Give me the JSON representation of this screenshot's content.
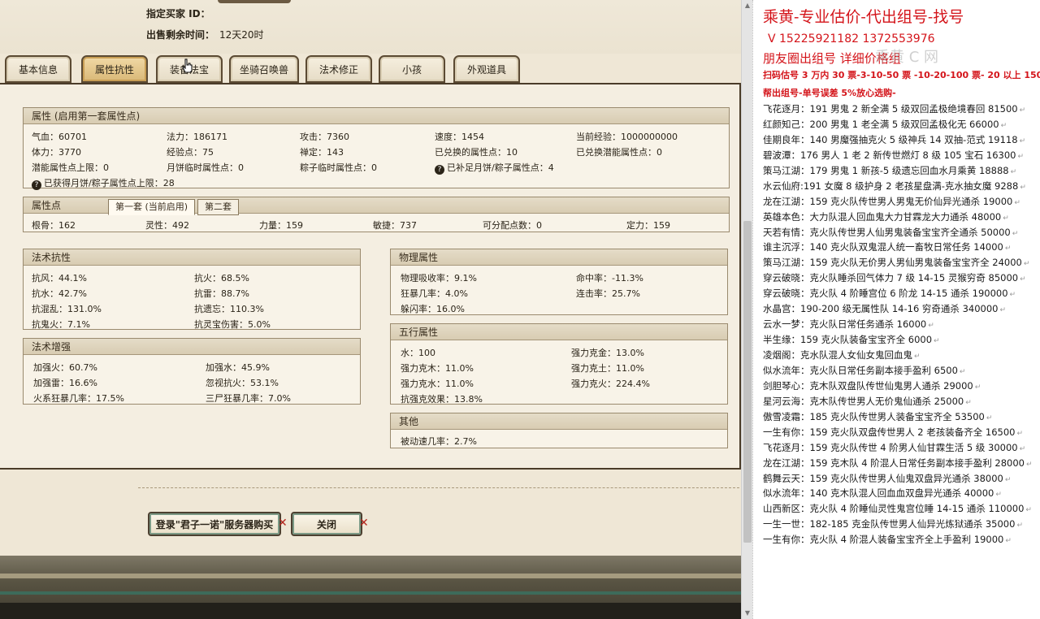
{
  "top_info": {
    "buyer_label": "指定买家 ID：",
    "remaining_label": "出售剩余时间：",
    "remaining_value": "12天20时"
  },
  "tabs": [
    {
      "label": "基本信息",
      "active": false
    },
    {
      "label": "属性抗性",
      "active": true
    },
    {
      "label": "装备法宝",
      "active": false
    },
    {
      "label": "坐骑召唤兽",
      "active": false
    },
    {
      "label": "法术修正",
      "active": false
    },
    {
      "label": "小孩",
      "active": false
    },
    {
      "label": "外观道具",
      "active": false
    }
  ],
  "attributes": {
    "title": "属性 (启用第一套属性点)",
    "row1": [
      "气血：60701",
      "法力：186171",
      "攻击：7360",
      "速度：1454",
      "当前经验：1000000000"
    ],
    "row2": [
      "体力：3770",
      "经验点：75",
      "禅定：143",
      "已兑换的属性点：10",
      "已兑换潜能属性点：0"
    ],
    "row3": [
      "潜能属性点上限：0",
      "月饼临时属性点：0",
      "粽子临时属性点：0",
      "已补足月饼/粽子属性点：4"
    ],
    "row4": "已获得月饼/粽子属性点上限：28"
  },
  "attr_points": {
    "title": "属性点",
    "subtab1": "第一套 (当前启用)",
    "subtab2": "第二套",
    "values": [
      "根骨：162",
      "灵性：492",
      "力量：159",
      "敏捷：737",
      "可分配点数：0",
      "定力：159"
    ]
  },
  "resist": {
    "title": "法术抗性",
    "rows": [
      [
        "抗风：44.1%",
        "抗火：68.5%"
      ],
      [
        "抗水：42.7%",
        "抗雷：88.7%"
      ],
      [
        "抗混乱：131.0%",
        "抗遗忘：110.3%"
      ],
      [
        "抗鬼火：7.1%",
        "抗灵宝伤害：5.0%"
      ]
    ]
  },
  "enhance": {
    "title": "法术增强",
    "rows": [
      [
        "加强火：60.7%",
        "加强水：45.9%"
      ],
      [
        "加强雷：16.6%",
        "忽视抗火：53.1%"
      ],
      [
        "火系狂暴几率：17.5%",
        "三尸狂暴几率：7.0%"
      ]
    ]
  },
  "physical": {
    "title": "物理属性",
    "rows": [
      [
        "物理吸收率：9.1%",
        "命中率：-11.3%"
      ],
      [
        "狂暴几率：4.0%",
        "连击率：25.7%"
      ],
      [
        "躲闪率：16.0%",
        ""
      ]
    ]
  },
  "five_elements": {
    "title": "五行属性",
    "rows": [
      [
        "水：100",
        "强力克金：13.0%"
      ],
      [
        "强力克木：11.0%",
        "强力克土：11.0%"
      ],
      [
        "强力克水：11.0%",
        "强力克火：224.4%"
      ],
      [
        "抗强克效果：13.8%",
        ""
      ]
    ]
  },
  "other": {
    "title": "其他",
    "value": "被动速几率：2.7%"
  },
  "buttons": {
    "login_buy": "登录\"君子一诺\"服务器购买",
    "close": "关闭"
  },
  "notes": {
    "title": "乘黄-专业估价-代出组号-找号",
    "phone": "V 15225921182   1372553976",
    "circle": "朋友圈出组号    详细价格组",
    "watermark": "乘黄 C 网",
    "price1": "扫码估号 3 万内 30 票-3-10-50 票 -10-20-100 票- 20 以上 150",
    "price2": "帮出组号-单号误差 5%放心选购-",
    "listing": [
      "飞花逐月：191 男鬼 2 新全满 5 级双回孟极绝境春回 81500",
      "红颜知己：200 男鬼 1 老全满 5 级双回孟极化无 66000",
      "佳期良年：140 男魔强抽克火 5 级神兵 14 双抽-范式 19118",
      "碧波潭：176 男人 1 老 2 新传世燃灯 8 级 105 宝石 16300",
      "策马江湖：179 男鬼 1 新孩-5 级遗忘回血水月乘黄 18888",
      "水云仙府:191 女魔 8 级护身 2 老孩星盘满-克水抽女魔 9288",
      "龙在江湖：159 克火队传世男人男鬼无价仙异光通杀 19000",
      "英雄本色：大力队混人回血鬼大力甘霖龙大力通杀 48000",
      "天若有情：克火队传世男人仙男鬼装备宝宝齐全通杀 50000",
      "谁主沉浮：140 克火队双鬼混人统一畜牧日常任务 14000",
      "策马江湖：159 克火队无价男人男仙男鬼装备宝宝齐全 24000",
      "穿云破晓：克火队睡杀回气体力 7 级 14-15 灵猴穷奇 85000",
      "穿云破晓：克火队 4 阶睡宫位 6 阶龙 14-15 通杀 190000",
      "水晶宫：190-200 级无属性队 14-16 穷奇通杀 340000",
      "云水一梦：克火队日常任务通杀 16000",
      "半生缘：159 克火队装备宝宝齐全 6000",
      "凌烟阁：克水队混人女仙女鬼回血鬼",
      "似水流年：克火队日常任务副本接手盈利 6500",
      "剑胆琴心：克木队双盘队传世仙鬼男人通杀 29000",
      "星河云海：克木队传世男人无价鬼仙通杀 25000",
      "傲雪凌霜：185 克火队传世男人装备宝宝齐全 53500",
      "一生有你：159 克火队双盘传世男人 2 老孩装备齐全 16500",
      "飞花逐月：159 克火队传世 4 阶男人仙甘霖生活 5 级 30000",
      "龙在江湖：159 克木队 4 阶混人日常任务副本接手盈利 28000",
      "鹤舞云天：159 克火队传世男人仙鬼双盘异光通杀 38000",
      "似水流年：140 克木队混人回血血双盘异光通杀 40000",
      "山西新区：克火队 4 阶睡仙灵性鬼宫位睡 14-15 通杀 110000",
      "一生一世：182-185 克金队传世男人仙异光炼狱通杀 35000",
      "一生有你：克火队 4 阶混人装备宝宝齐全上手盈利 19000"
    ]
  }
}
